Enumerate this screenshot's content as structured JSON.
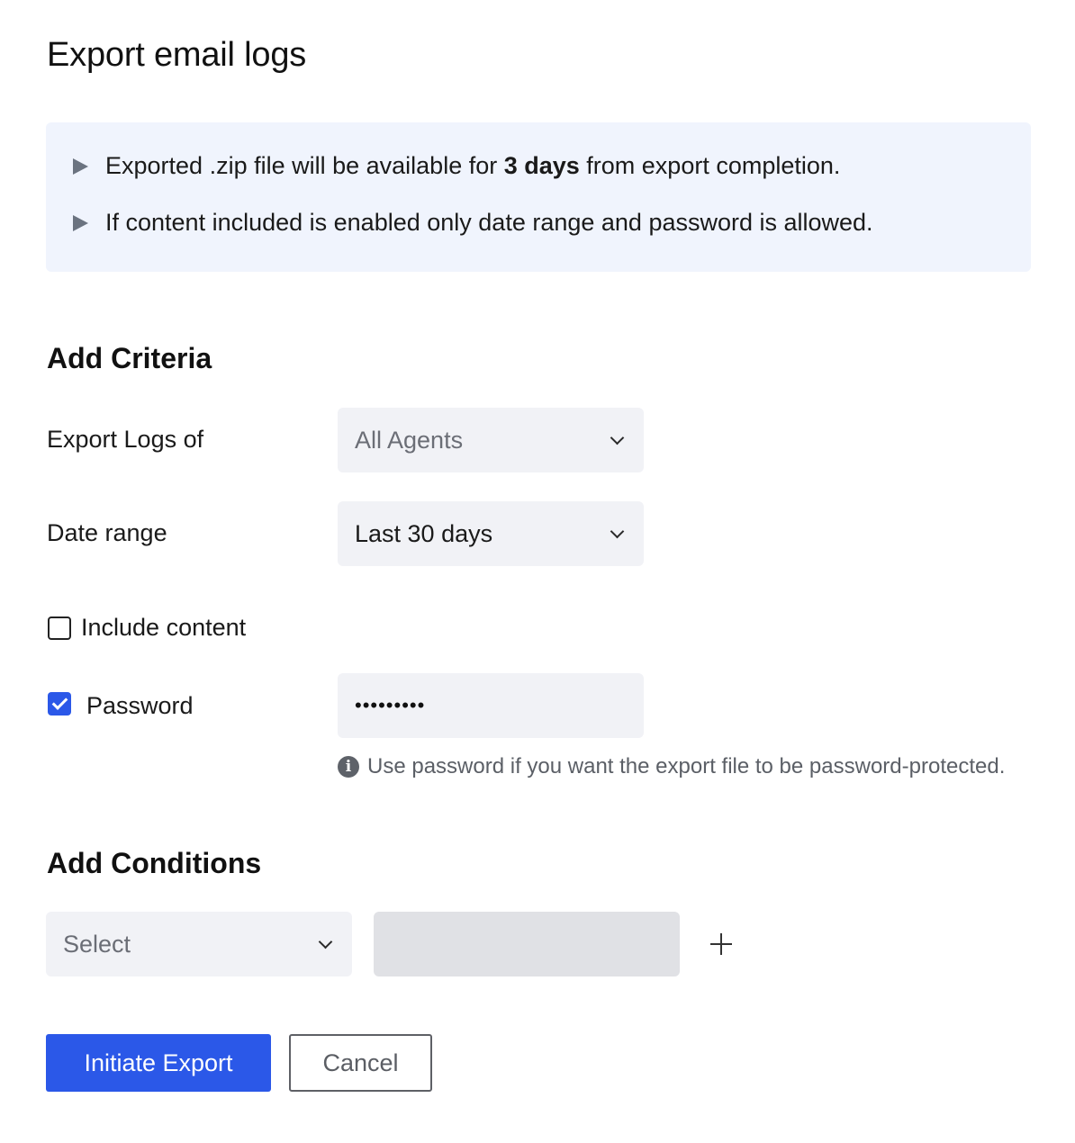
{
  "title": "Export email logs",
  "notice": {
    "line1_prefix": "Exported .zip file will be available for ",
    "line1_bold": "3 days",
    "line1_suffix": " from export completion.",
    "line2": "If content included is enabled only date range and password is allowed."
  },
  "criteria": {
    "heading": "Add Criteria",
    "export_logs_label": "Export Logs of",
    "export_logs_value": "All Agents",
    "date_range_label": "Date range",
    "date_range_value": "Last 30 days",
    "include_content_label": "Include content",
    "include_content_checked": false,
    "password_label": "Password",
    "password_checked": true,
    "password_value": "•••••••••",
    "password_hint": "Use password if you want the export file to be password-protected."
  },
  "conditions": {
    "heading": "Add Conditions",
    "select_placeholder": "Select",
    "value_field": ""
  },
  "actions": {
    "primary_label": "Initiate Export",
    "cancel_label": "Cancel"
  },
  "icons": {
    "notice_bullet": "triangle-right-icon",
    "dropdown": "chevron-down-icon",
    "hint": "info-icon",
    "add": "plus-icon"
  },
  "colors": {
    "accent": "#2b58e8",
    "notice_bg": "#f0f4fd",
    "field_bg": "#f1f2f6",
    "disabled_field_bg": "#e0e1e5"
  }
}
